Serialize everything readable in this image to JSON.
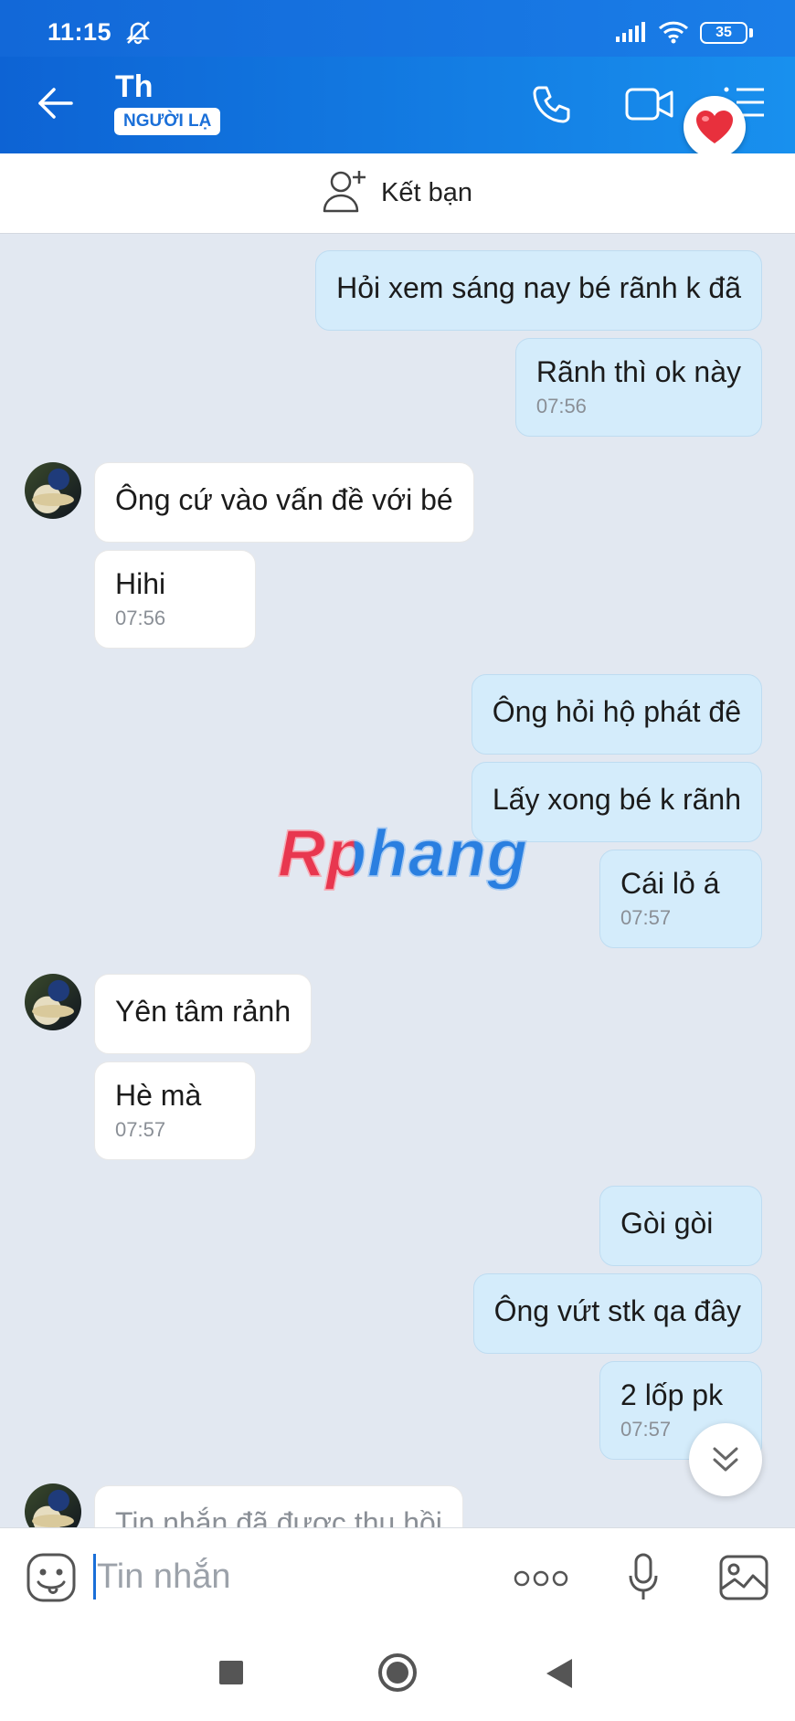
{
  "status_bar": {
    "time": "11:15",
    "battery": "35"
  },
  "header": {
    "contact_name": "Th",
    "badge": "NGƯỜI LẠ"
  },
  "add_friend": {
    "label": "Kết bạn"
  },
  "messages": [
    {
      "from": "me",
      "text": "Hỏi xem sáng nay bé rãnh k đã",
      "time": ""
    },
    {
      "from": "me",
      "text": "Rãnh thì ok này",
      "time": "07:56"
    },
    {
      "from": "them",
      "text": "Ông cứ vào vấn đề với bé",
      "time": ""
    },
    {
      "from": "them",
      "text": "Hihi",
      "time": "07:56"
    },
    {
      "from": "me",
      "text": "Ông hỏi hộ phát đê",
      "time": ""
    },
    {
      "from": "me",
      "text": "Lấy xong bé k rãnh",
      "time": ""
    },
    {
      "from": "me",
      "text": "Cái lỏ á",
      "time": "07:57"
    },
    {
      "from": "them",
      "text": "Yên tâm rảnh",
      "time": ""
    },
    {
      "from": "them",
      "text": "Hè mà",
      "time": "07:57"
    },
    {
      "from": "me",
      "text": "Gòi gòi",
      "time": ""
    },
    {
      "from": "me",
      "text": "Ông vứt stk qa đây",
      "time": ""
    },
    {
      "from": "me",
      "text": "2 lốp pk",
      "time": "07:57"
    },
    {
      "from": "them",
      "text": "Tin nhắn đã được thu hồi",
      "time": ""
    }
  ],
  "watermark": "Rphang",
  "input": {
    "placeholder": "Tin nhắn"
  },
  "colors": {
    "header": "#1a7ee8",
    "my_bubble": "#d4ecfb",
    "their_bubble": "#ffffff",
    "chat_bg": "#e2e8f1"
  }
}
